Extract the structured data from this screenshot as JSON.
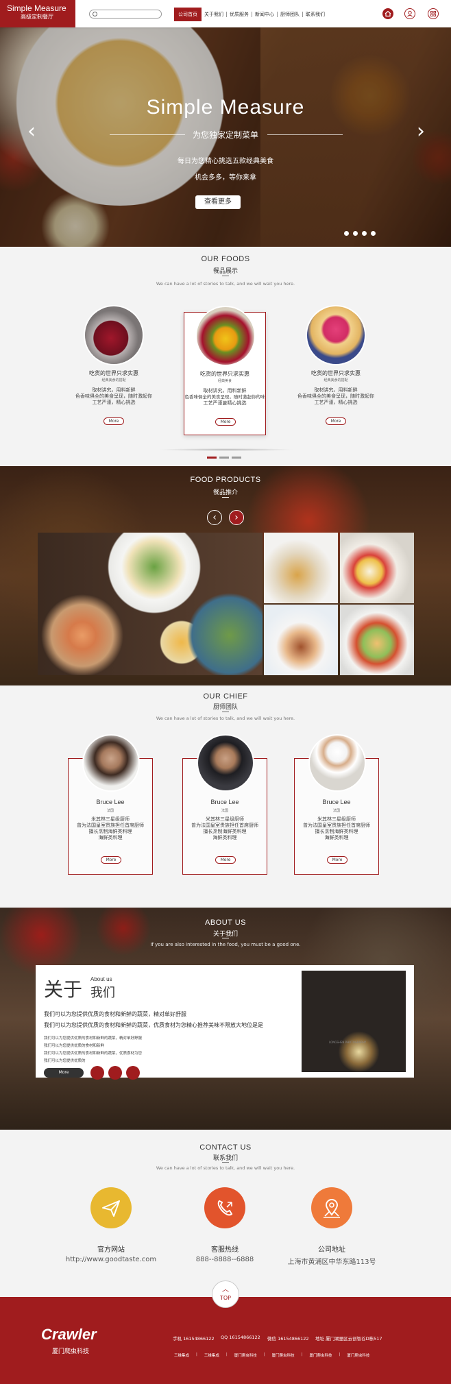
{
  "header": {
    "logo_title": "Simple  Measure",
    "logo_sub": "高级定制餐厅",
    "nav": [
      "公司首页",
      "关于我们",
      "优质服务",
      "新闻中心",
      "厨师团队",
      "联系我们"
    ],
    "icons": [
      "home-icon",
      "user-icon",
      "grid-icon"
    ]
  },
  "banner": {
    "title": "Simple  Measure",
    "subtitle": "为您独家定制菜单",
    "desc1": "每日为您精心挑选五款经典美食",
    "desc2": "机会多多，等你来拿",
    "button": "查看更多",
    "slides": 4,
    "active_slide": 1
  },
  "foods": {
    "en": "OUR FOODS",
    "cn": "餐品展示",
    "desc": "We can have a lot of stories to talk, and we will wait you here.",
    "cards": [
      {
        "title": "吃货的世界只求实惠",
        "small": "经典美食的搭配",
        "l1": "取材讲究，用料新鲜",
        "l2": "色香味俱全的美食呈现，随时激起你",
        "l3": "工艺严谨，精心挑选",
        "more": "More"
      },
      {
        "title": "吃货的世界只求实惠",
        "small": "经典美食",
        "l1": "取材讲究，用料新鲜",
        "l2": "色香味俱全的美食呈现，随时激起你的味蕾",
        "l3": "工艺严谨，精心挑选",
        "more": "More"
      },
      {
        "title": "吃货的世界只求实惠",
        "small": "经典美食的搭配",
        "l1": "取材讲究，用料新鲜",
        "l2": "色香味俱全的美食呈现，随时激起你",
        "l3": "工艺严谨，精心挑选",
        "more": "More"
      }
    ]
  },
  "products": {
    "en": "FOOD PRODUCTS",
    "cn": "餐品推介"
  },
  "chief": {
    "en": "OUR CHIEF",
    "cn": "厨师团队",
    "desc": "We can have a lot of stories to talk, and we will wait you here.",
    "cards": [
      {
        "name": "Bruce Lee",
        "role": "法国",
        "l1": "米其林三星级厨师",
        "l2": "曾为法国皇室贵族担任首席厨师",
        "l3": "擅长烹制海鲜类料理",
        "l4": "海鲜类料理",
        "more": "More"
      },
      {
        "name": "Bruce Lee",
        "role": "法国",
        "l1": "米其林三星级厨师",
        "l2": "曾为法国皇室贵族担任首席厨师",
        "l3": "擅长烹制海鲜类料理",
        "l4": "海鲜类料理",
        "more": "More"
      },
      {
        "name": "Bruce Lee",
        "role": "法国",
        "l1": "米其林三星级厨师",
        "l2": "曾为法国皇室贵族担任首席厨师",
        "l3": "擅长烹制海鲜类料理",
        "l4": "海鲜类料理",
        "more": "More"
      }
    ]
  },
  "about": {
    "en": "ABOUT US",
    "cn": "关于我们",
    "desc": "If you are also interested in the food, you must be a good one.",
    "big1": "关于",
    "about_en": "About us",
    "big2": "我们",
    "p1": "我们可以为您提供优质的食材和新鲜的蔬菜，精对单好舒服",
    "p2": "我们可以为您提供优质的食材和新鲜的蔬菜，优质食材为您精心推荐美味不限放大地位是是",
    "s1": "我们可以为您提供优质的食材和新鲜的蔬菜，精对单好舒服",
    "s2": "我们可以为您提供优质的食材和新鲜",
    "s3": "我们可以为您提供优质的食材和新鲜的蔬菜，优质食材为您",
    "s4": "我们可以为您提供优质的",
    "more": "More",
    "watermark": "LONGSHEN PHOTOGRAPHY"
  },
  "contact": {
    "en": "CONTACT US",
    "cn": "联系我们",
    "desc": "We can have a lot of stories to talk, and we will wait you here.",
    "items": [
      {
        "title": "官方网站",
        "value": "http://www.goodtaste.com",
        "color": "#e8b830"
      },
      {
        "title": "客服热线",
        "value": "888--8888--6888",
        "color": "#e2542c"
      },
      {
        "title": "公司地址",
        "value": "上海市黄浦区中华东路113号",
        "color": "#ef7a3a"
      }
    ]
  },
  "top": "TOP",
  "footer": {
    "brand": "Crawler",
    "brand_sub": "厦门爬虫科技",
    "info": [
      "手机 16154866122",
      "QQ 16154866122",
      "微信 16154866122",
      "地址 厦门湖里区云创智谷D栋517"
    ],
    "links": [
      "三维集成",
      "三维集成",
      "厦门爬虫科技",
      "厦门爬虫科技",
      "厦门爬虫科技",
      "厦门爬虫科技"
    ]
  }
}
